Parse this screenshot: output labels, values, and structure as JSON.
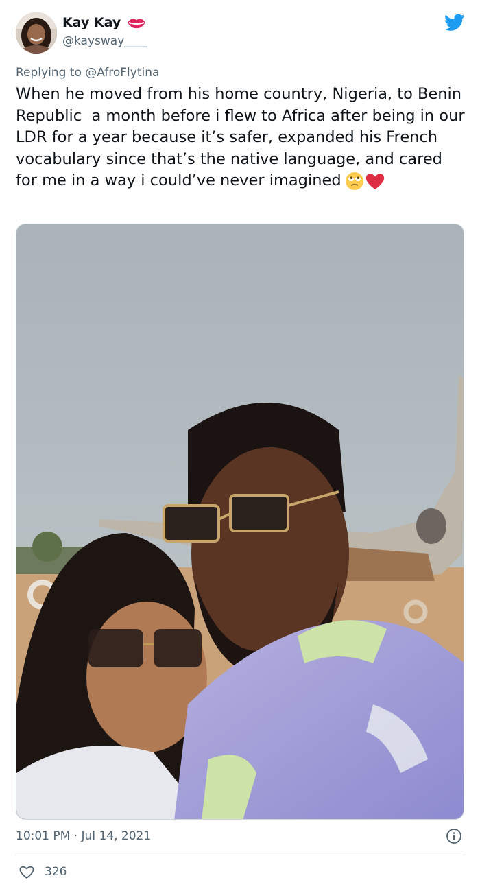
{
  "author": {
    "name": "Kay Kay",
    "handle": "@kaysway____",
    "name_icon": "lips-kiss-icon",
    "avatar_icon": "avatar"
  },
  "reply": {
    "prefix": "Replying to ",
    "mention": "@AfroFlytina"
  },
  "tweet": {
    "text": "When he moved from his home country, Nigeria, to Benin Republic  a month before i flew to Africa after being in our LDR for a year because it’s safer, expanded his French vocabulary since that’s the native language, and cared for me in a way i could’ve never imagined",
    "emojis": [
      "face-with-rolling-eyes-emoji",
      "red-heart-emoji"
    ]
  },
  "photo": {
    "description_icon": "photo-couple-selfie"
  },
  "meta": {
    "timestamp": "10:01 PM · Jul 14, 2021"
  },
  "stats": {
    "likes": "326"
  },
  "colors": {
    "text": "#0f1419",
    "secondary": "#536471",
    "twitter_blue": "#1d9bf0",
    "divider": "#cfd9de"
  }
}
